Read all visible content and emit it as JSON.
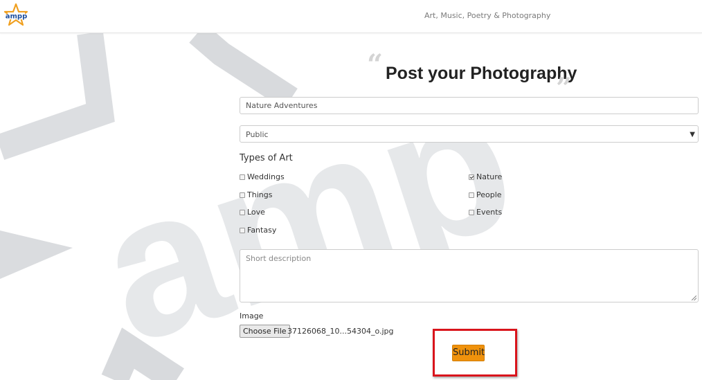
{
  "header": {
    "logo_text": "ampp",
    "tagline": "Art, Music, Poetry & Photography"
  },
  "page": {
    "quote_open": "“",
    "title": "Post your Photography",
    "quote_close": "”"
  },
  "form": {
    "title_value": "Nature Adventures",
    "visibility_selected": "Public",
    "types_label": "Types of Art",
    "art_types": [
      {
        "label": "Weddings",
        "checked": false
      },
      {
        "label": "Nature",
        "checked": true
      },
      {
        "label": "Things",
        "checked": false
      },
      {
        "label": "People",
        "checked": false
      },
      {
        "label": "Love",
        "checked": false
      },
      {
        "label": "Events",
        "checked": false
      },
      {
        "label": "Fantasy",
        "checked": false
      }
    ],
    "description_placeholder": "Short description",
    "image_label": "Image",
    "choose_file_label": "Choose File",
    "file_name": "37126068_10...54304_o.jpg",
    "submit_label": "Submit"
  },
  "colors": {
    "accent": "#f0920c",
    "highlight": "#d9141c",
    "logo_star": "#f0a020",
    "logo_text": "#1d4e9e"
  },
  "icons": [
    "ampp-logo-icon",
    "select-arrow-icon",
    "checkbox-icon",
    "resize-grip-icon",
    "ampp-watermark-icon"
  ]
}
